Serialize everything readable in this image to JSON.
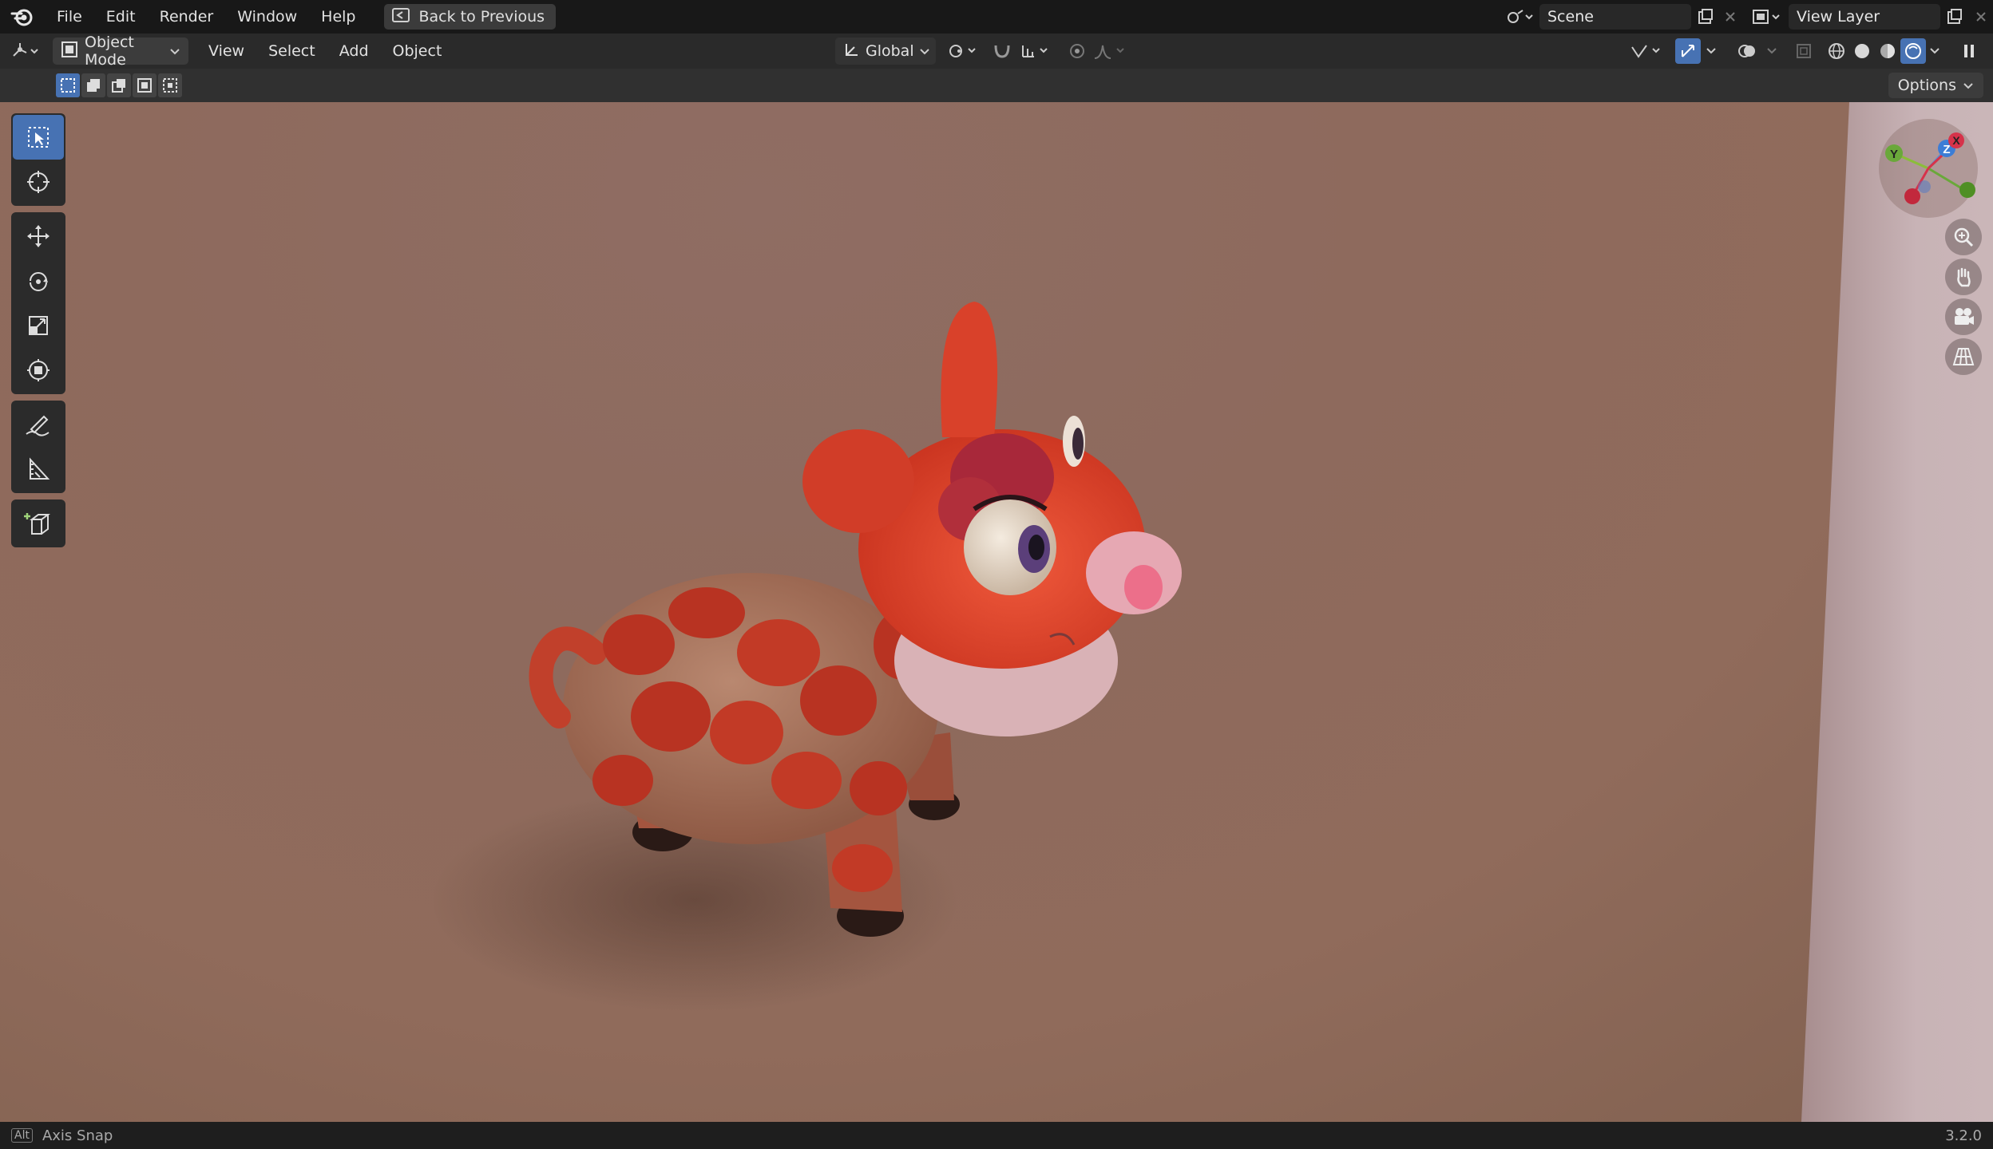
{
  "menu": {
    "items": [
      "File",
      "Edit",
      "Render",
      "Window",
      "Help"
    ],
    "back_button": "Back to Previous"
  },
  "scene": {
    "name": "Scene",
    "view_layer": "View Layer"
  },
  "header": {
    "mode": "Object Mode",
    "menus": [
      "View",
      "Select",
      "Add",
      "Object"
    ],
    "transform_orientation": "Global",
    "options_label": "Options"
  },
  "tools": [
    "select-box",
    "cursor",
    "move",
    "rotate",
    "scale",
    "transform",
    "annotate",
    "measure",
    "add-cube"
  ],
  "gizmo": {
    "axes": [
      "X",
      "Y",
      "Z"
    ]
  },
  "status": {
    "key": "Alt",
    "hint": "Axis Snap",
    "version": "3.2.0"
  },
  "colors": {
    "accent": "#4772b3",
    "viewport_bg": "#8e6a5d",
    "giraffe_body": "#c0402a"
  }
}
